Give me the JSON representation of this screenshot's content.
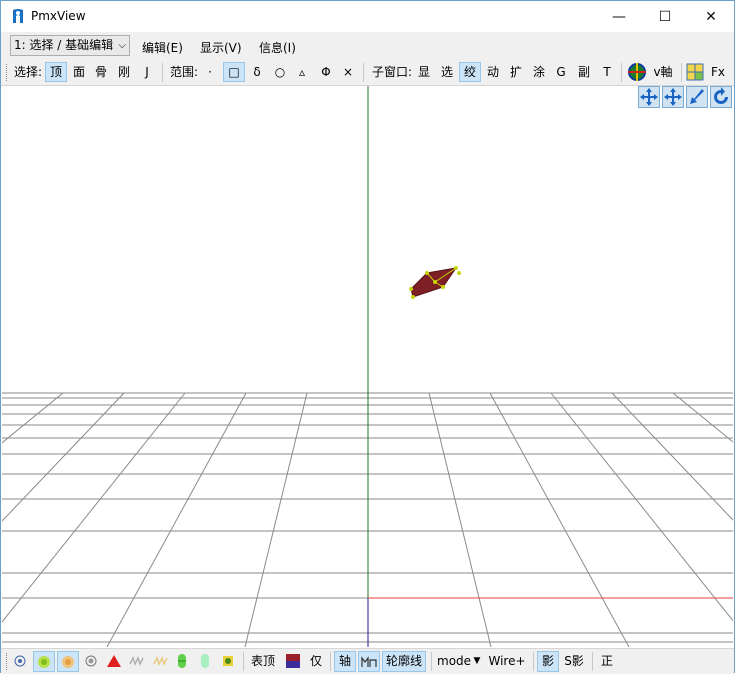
{
  "window": {
    "title": "PmxView",
    "controls": {
      "minimize": "—",
      "maximize": "☐",
      "close": "✕"
    }
  },
  "menubar": {
    "mode_combo": "1: 选择 / 基础编辑",
    "menus": [
      "编辑(E)",
      "显示(V)",
      "信息(I)"
    ]
  },
  "toolbar": {
    "select_label": "选择:",
    "select_items": [
      "顶",
      "面",
      "骨",
      "刚",
      "J"
    ],
    "range_label": "范围:",
    "range_items": [
      "·",
      "□",
      "δ",
      "○",
      "▵",
      "Φ",
      "×"
    ],
    "subwin_label": "子窗口:",
    "subwin_items": [
      "显",
      "选",
      "绞",
      "动",
      "扩",
      "涂",
      "G",
      "副",
      "T"
    ],
    "vaxis_label": "v軸",
    "fx_label": "Fx"
  },
  "statusbar": {
    "surface_vertex": "表顶",
    "only": "仅",
    "axis": "轴",
    "outline": "轮廓线",
    "mode": "mode",
    "wire": "Wire+",
    "shadow": "影",
    "s_shadow": "S影",
    "ortho": "正"
  },
  "colors": {
    "accent_selected": "#cce4f7",
    "model": "#7d1f24",
    "vertex": "#c8d400",
    "axis_x": "#e8413a",
    "axis_y": "#1a7a1a",
    "axis_z": "#1e1e8c",
    "grid": "#8a8a8a"
  }
}
